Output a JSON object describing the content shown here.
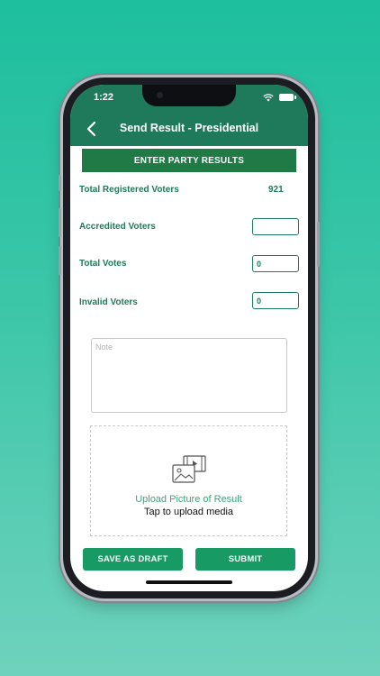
{
  "status_bar": {
    "time": "1:22"
  },
  "header": {
    "title": "Send Result - Presidential"
  },
  "section_header": "ENTER PARTY RESULTS",
  "fields": {
    "total_registered": {
      "label": "Total Registered Voters",
      "value": "921"
    },
    "accredited": {
      "label": "Accredited Voters",
      "value": ""
    },
    "total_votes": {
      "label": "Total Votes",
      "value": "0"
    },
    "invalid": {
      "label": "Invalid Voters",
      "value": "0"
    }
  },
  "note": {
    "placeholder": "Note"
  },
  "upload": {
    "title": "Upload Picture of Result",
    "subtitle": "Tap to upload media"
  },
  "buttons": {
    "draft": "SAVE AS DRAFT",
    "submit": "SUBMIT"
  },
  "colors": {
    "primary": "#1f7a5c",
    "button": "#179a63",
    "background": "#1dbf9e"
  },
  "icons": [
    "back-chevron-icon",
    "wifi-icon",
    "battery-icon",
    "media-upload-icon"
  ]
}
